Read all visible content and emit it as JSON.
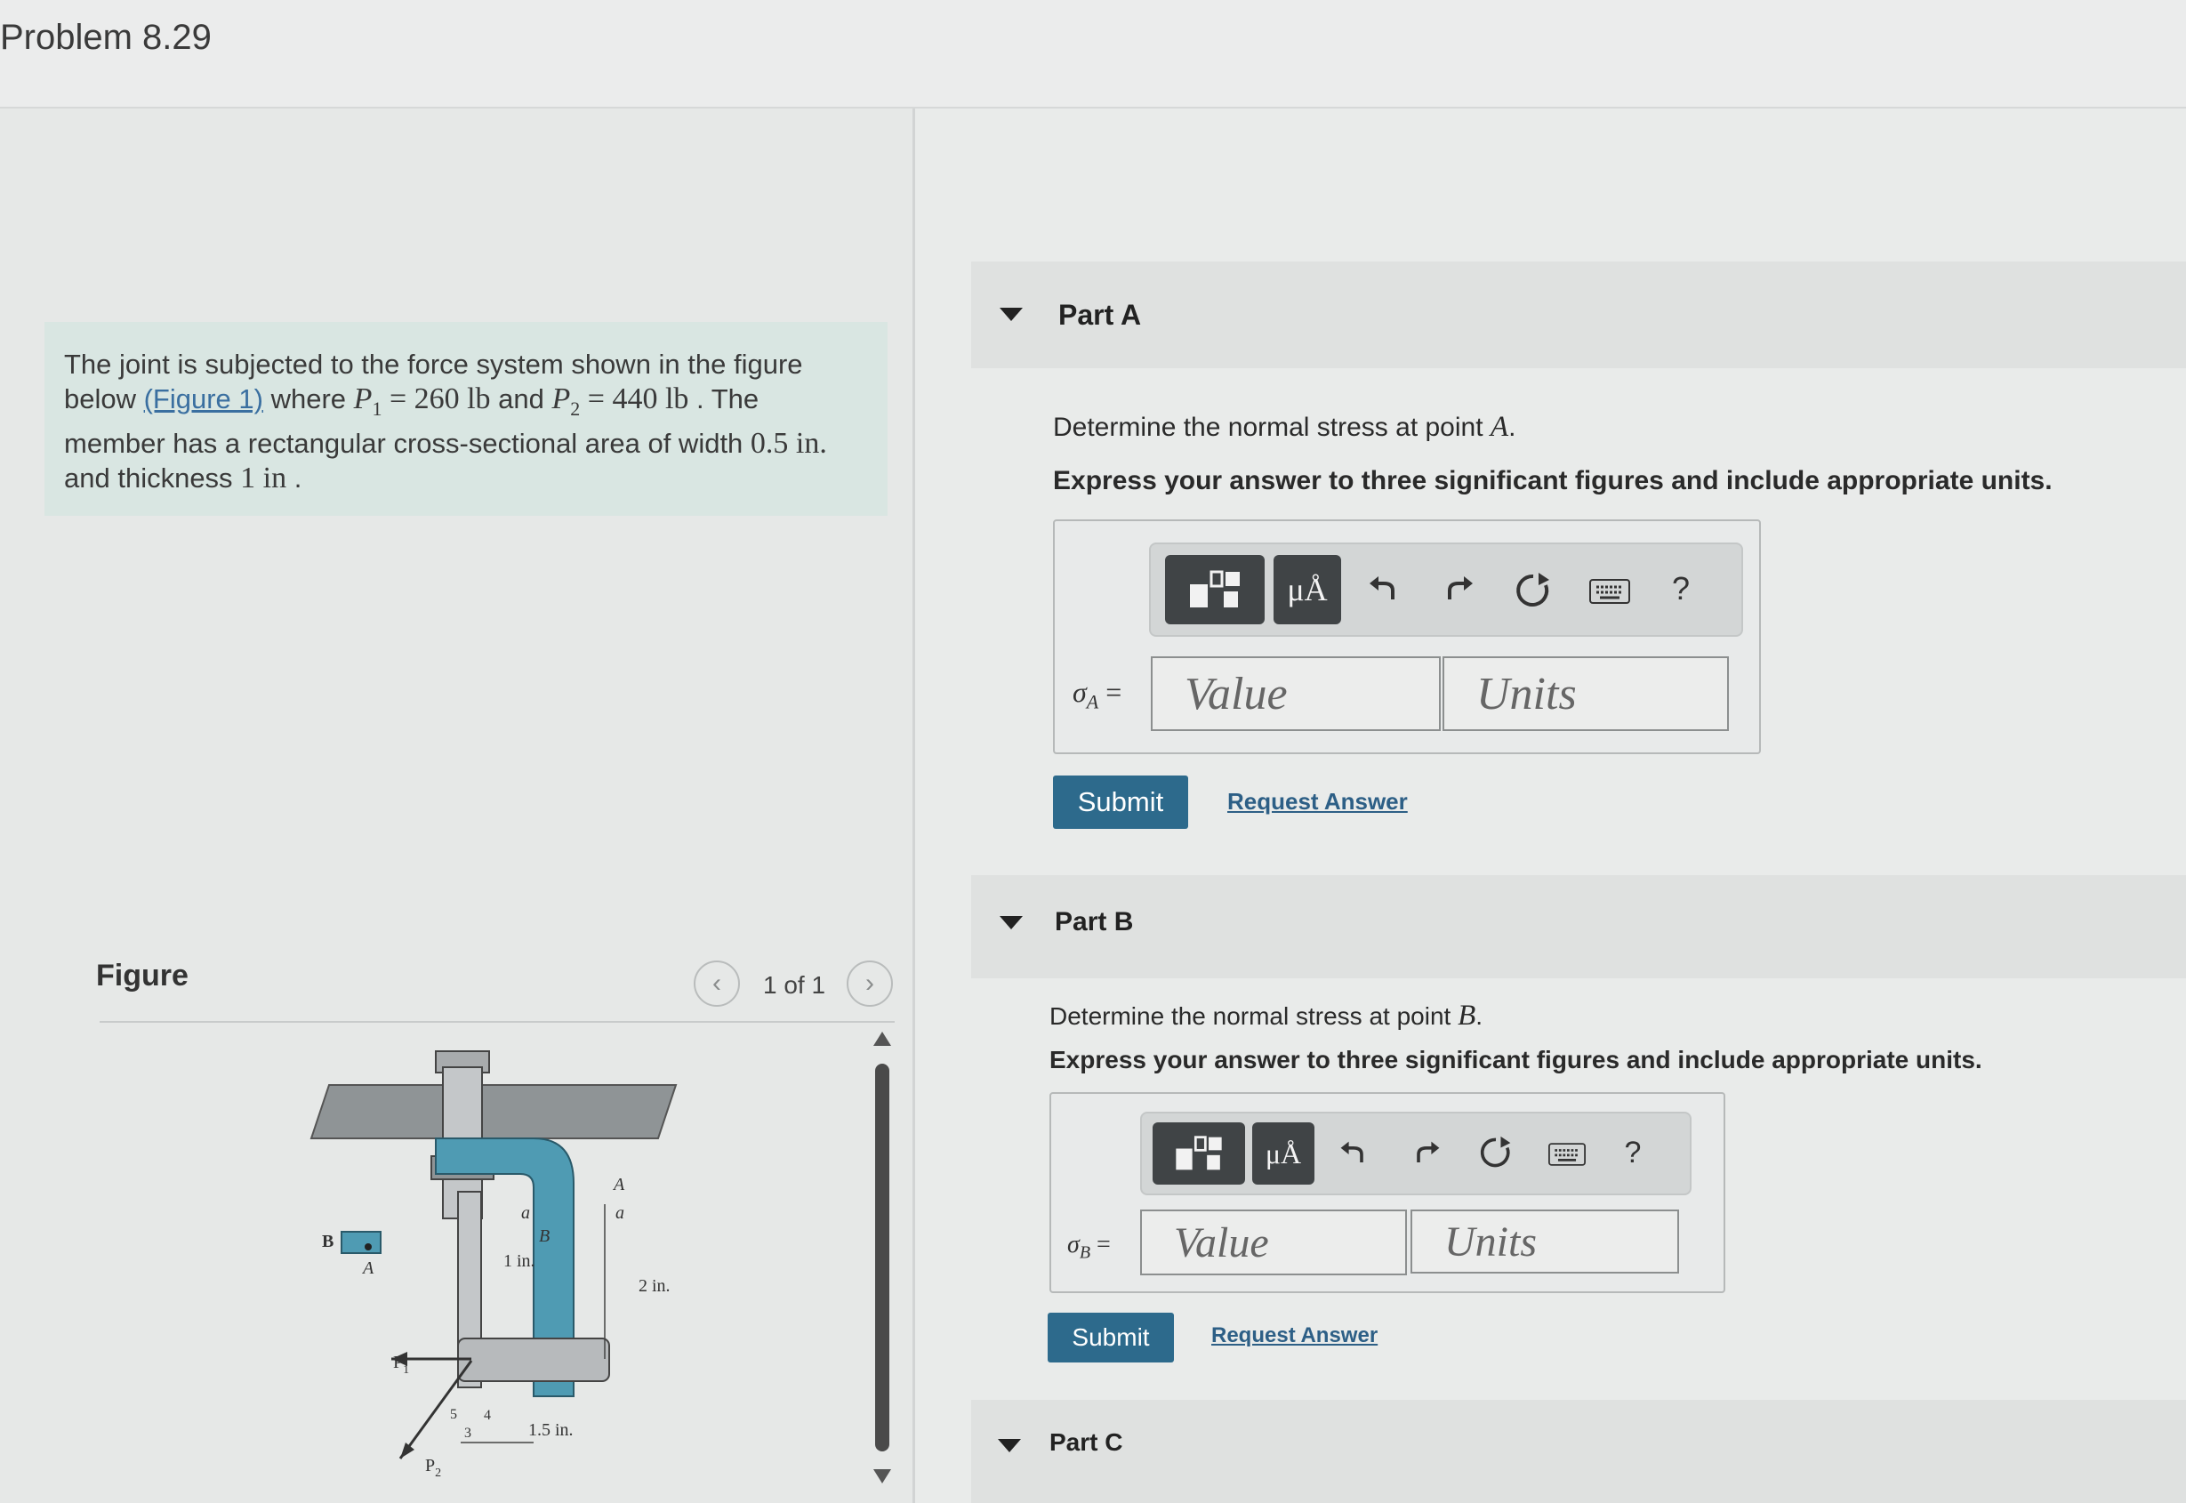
{
  "problem": {
    "title": "Problem 8.29",
    "statement": {
      "line1": "The joint is subjected to the force system shown in the figure",
      "line2_pre": "below ",
      "figure_link": "(Figure 1)",
      "line2_mid": " where ",
      "p1": "P",
      "p1_sub": "1",
      "p1_value": " = 260 lb",
      "and": " and ",
      "p2": "P",
      "p2_sub": "2",
      "p2_value": " = 440 lb",
      "line2_end": " . The",
      "line3_pre": "member has a rectangular cross-sectional area of width ",
      "width_value": "0.5 in.",
      "line4_pre": "and thickness ",
      "thickness_value": "1 in",
      "line4_end": " ."
    }
  },
  "figure": {
    "label": "Figure",
    "page": "1 of 1",
    "labels": {
      "b_left": "B",
      "a_left": "A",
      "a_small": "a",
      "b_mid": "B",
      "one_in": "1 in.",
      "a_right": "A",
      "a_right_small": "a",
      "two_in": "2 in.",
      "p1": "P",
      "p1_sub": "1",
      "p2": "P",
      "p2_sub": "2",
      "five": "5",
      "four": "4",
      "three": "3",
      "one_five_in": "1.5 in."
    }
  },
  "parts": [
    {
      "title": "Part A",
      "question_pre": "Determine the normal stress at point ",
      "question_point": "A",
      "question_end": ".",
      "instruction": "Express your answer to three significant figures and include appropriate units.",
      "symbol": "σ",
      "symbol_sub": "A",
      "equals": "=",
      "value_placeholder": "Value",
      "units_placeholder": "Units",
      "submit_label": "Submit",
      "request_label": "Request Answer"
    },
    {
      "title": "Part B",
      "question_pre": "Determine the normal stress at point ",
      "question_point": "B",
      "question_end": ".",
      "instruction": "Express your answer to three significant figures and include appropriate units.",
      "symbol": "σ",
      "symbol_sub": "B",
      "equals": "=",
      "value_placeholder": "Value",
      "units_placeholder": "Units",
      "submit_label": "Submit",
      "request_label": "Request Answer"
    },
    {
      "title": "Part C"
    }
  ],
  "toolbar": {
    "units_symbol": "μÅ",
    "help": "?",
    "icons": [
      "templates-icon",
      "units-icon",
      "undo-icon",
      "redo-icon",
      "reset-icon",
      "keyboard-icon",
      "help-icon"
    ]
  },
  "colors": {
    "submit": "#2d6a8c",
    "link": "#2d5f86",
    "problem_box": "#d9e6e2",
    "toolbar_button": "#404446",
    "member_blue": "#4f9bb3"
  }
}
